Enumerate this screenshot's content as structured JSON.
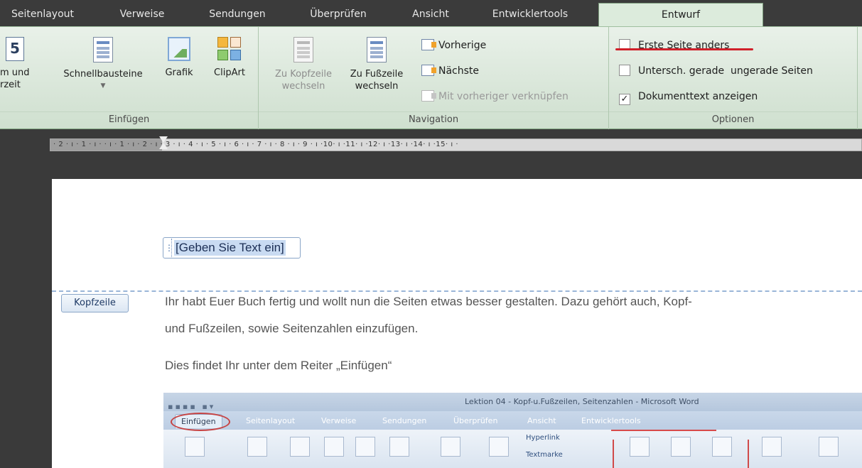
{
  "tabs": [
    {
      "label": "Seitenlayout",
      "active": false
    },
    {
      "label": "Verweise",
      "active": false
    },
    {
      "label": "Sendungen",
      "active": false
    },
    {
      "label": "Überprüfen",
      "active": false
    },
    {
      "label": "Ansicht",
      "active": false
    },
    {
      "label": "Entwicklertools",
      "active": false
    },
    {
      "label": "Entwurf",
      "active": true
    }
  ],
  "ribbon": {
    "insert_group": {
      "label": "Einfügen",
      "datum_line1": "m und",
      "datum_line2": "rzeit",
      "calendar_glyph": "5",
      "schnellbausteine": "Schnellbausteine",
      "grafik": "Grafik",
      "clipart": "ClipArt"
    },
    "navigation_group": {
      "label": "Navigation",
      "kopfzeile_line1": "Zu Kopfzeile",
      "kopfzeile_line2": "wechseln",
      "fusszeile_line1": "Zu Fußzeile",
      "fusszeile_line2": "wechseln",
      "vorherige": "Vorherige",
      "naechste": "Nächste",
      "verknuepfen": "Mit vorheriger verknüpfen"
    },
    "options_group": {
      "label": "Optionen",
      "options": [
        {
          "label": "Erste Seite anders",
          "checked": false
        },
        {
          "label": "Untersch. gerade  ungerade Seiten",
          "checked": false
        },
        {
          "label": "Dokumenttext anzeigen",
          "checked": true
        }
      ]
    }
  },
  "ruler": {
    "scale_text": "· 2 · ı · 1 · ı ·      · ı · 1 · ı · 2 · ı · 3 · ı · 4 · ı · 5 · ı · 6 · ı · 7 · ı · 8 · ı · 9 · ı ·10· ı ·11· ı ·12· ı ·13· ı ·14· ı ·15· ı ·"
  },
  "document": {
    "header_placeholder": "[Geben Sie Text ein]",
    "header_tag": "Kopfzeile",
    "paragraph1_line1": "Ihr habt Euer Buch fertig und wollt nun die Seiten etwas besser gestalten. Dazu gehört auch, Kopf-",
    "paragraph1_line2": "und Fußzeilen, sowie Seitenzahlen einzufügen.",
    "paragraph2": "Dies findet Ihr unter dem Reiter „Einfügen“"
  },
  "embedded_screenshot": {
    "window_title": "Lektion 04 - Kopf-u.Fußzeilen, Seitenzahlen  -  Microsoft Word",
    "tabs": [
      "Einfügen",
      "Seitenlayout",
      "Verweise",
      "Sendungen",
      "Überprüfen",
      "Ansicht",
      "Entwicklertools"
    ],
    "hyperlink": "Hyperlink",
    "textmarke": "Textmarke"
  },
  "colors": {
    "ribbon_accent": "#dcebdc",
    "annotation_red": "#d0202a"
  }
}
